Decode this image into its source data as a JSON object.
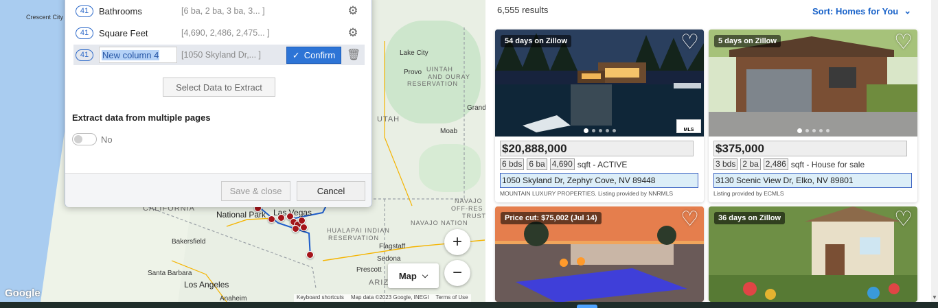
{
  "map": {
    "cities": {
      "crescent_city": "Crescent City",
      "lake_city": "Lake City",
      "provo": "Provo",
      "grand_junction": "Grand",
      "moab": "Moab",
      "bakersfield": "Bakersfield",
      "santa_barbara": "Santa Barbara",
      "los_angeles": "Los Angeles",
      "anaheim": "Anaheim",
      "las_vegas": "Las Vegas",
      "flagstaff": "Flagstaff",
      "sedona": "Sedona",
      "prescott": "Prescott",
      "national_park": "National Park"
    },
    "regions": {
      "utah": "UTAH",
      "california": "CALIFORNIA",
      "arizona": "ARIZ",
      "uintah": "UINTAH",
      "and_ouray": "AND OURAY",
      "reservation": "RESERVATION",
      "hualapai": "HUALAPAI INDIAN",
      "hualapai_res": "RESERVATION",
      "navajo": "NAVAJO",
      "off_res": "OFF-RES",
      "trust": "TRUST",
      "navajo_nation": "NAVAJO NATION"
    },
    "map_type_label": "Map",
    "zoom_in": "+",
    "zoom_out": "−",
    "google": "Google",
    "attribution": {
      "shortcuts": "Keyboard shortcuts",
      "data": "Map data ©2023 Google, INEGI",
      "terms": "Terms of Use"
    }
  },
  "dialog": {
    "rows": [
      {
        "count": "41",
        "name": "Bathrooms",
        "sample": "[6 ba, 2 ba, 3 ba, 3... ]"
      },
      {
        "count": "41",
        "name": "Square Feet",
        "sample": "[4,690, 2,486, 2,475... ]"
      },
      {
        "count": "41",
        "name": "New column 4",
        "sample": "[1050 Skyland Dr,... ]"
      }
    ],
    "confirm_label": "Confirm",
    "select_data_label": "Select Data to Extract",
    "multi_page_title": "Extract data from multiple pages",
    "toggle_label": "No",
    "save_close_label": "Save & close",
    "cancel_label": "Cancel"
  },
  "listings": {
    "results_count": "6,555 results",
    "sort_label": "Sort: Homes for You",
    "cards": [
      {
        "badge": "54 days on Zillow",
        "price": "$20,888,000",
        "beds": "6 bds",
        "baths": "6 ba",
        "sqft": "4,690",
        "sqft_suffix": "sqft - ACTIVE",
        "address": "1050 Skyland Dr, Zephyr Cove, NV 89448",
        "broker": "MOUNTAIN LUXURY PROPERTIES. Listing provided by NNRMLS",
        "mls": "MLS"
      },
      {
        "badge": "5 days on Zillow",
        "price": "$375,000",
        "beds": "3 bds",
        "baths": "2 ba",
        "sqft": "2,486",
        "sqft_suffix": "sqft - House for sale",
        "address": "3130 Scenic View Dr, Elko, NV 89801",
        "broker": "Listing provided by ECMLS"
      },
      {
        "badge": "Price cut: $75,002 (Jul 14)"
      },
      {
        "badge": "36 days on Zillow"
      }
    ]
  },
  "colors": {
    "accent": "#2d74d6",
    "link": "#1a63c9",
    "pin": "#a4141a"
  }
}
